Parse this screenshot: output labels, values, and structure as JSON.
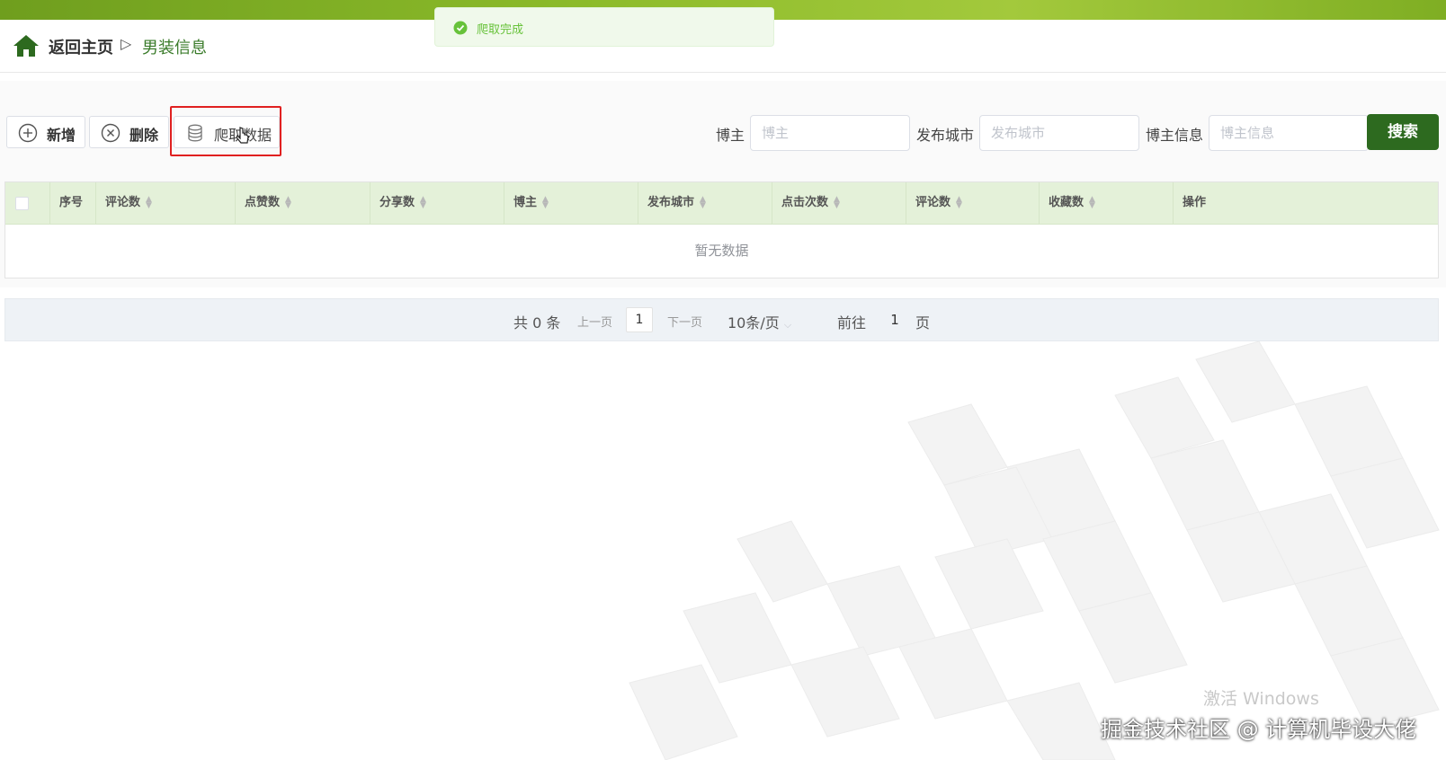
{
  "breadcrumb": {
    "home_label": "返回主页",
    "separator": "▷",
    "current": "男装信息"
  },
  "toast": {
    "message": "爬取完成",
    "icon": "success-check-icon"
  },
  "toolbar": {
    "add_label": "新增",
    "delete_label": "删除",
    "crawl_label": "爬取数据"
  },
  "search": {
    "blogger_label": "博主",
    "blogger_placeholder": "博主",
    "city_label": "发布城市",
    "city_placeholder": "发布城市",
    "info_label": "博主信息",
    "info_placeholder": "博主信息",
    "button_label": "搜索"
  },
  "table": {
    "columns": [
      "序号",
      "评论数",
      "点赞数",
      "分享数",
      "博主",
      "发布城市",
      "点击次数",
      "评论数",
      "收藏数",
      "操作"
    ],
    "empty_text": "暂无数据"
  },
  "pagination": {
    "total": "共 0 条",
    "prev": "上一页",
    "current_page": "1",
    "next": "下一页",
    "page_size": "10条/页",
    "goto_label": "前往",
    "goto_value": "1",
    "page_suffix": "页"
  },
  "watermarks": {
    "windows": "激活 Windows",
    "juejin": "掘金技术社区 @ 计算机毕设大佬"
  },
  "colors": {
    "brand_green": "#2d6a1f",
    "header_green": "#e4f1d9",
    "breadcrumb_current": "#3a7b2a",
    "highlight_red": "#e02020"
  }
}
